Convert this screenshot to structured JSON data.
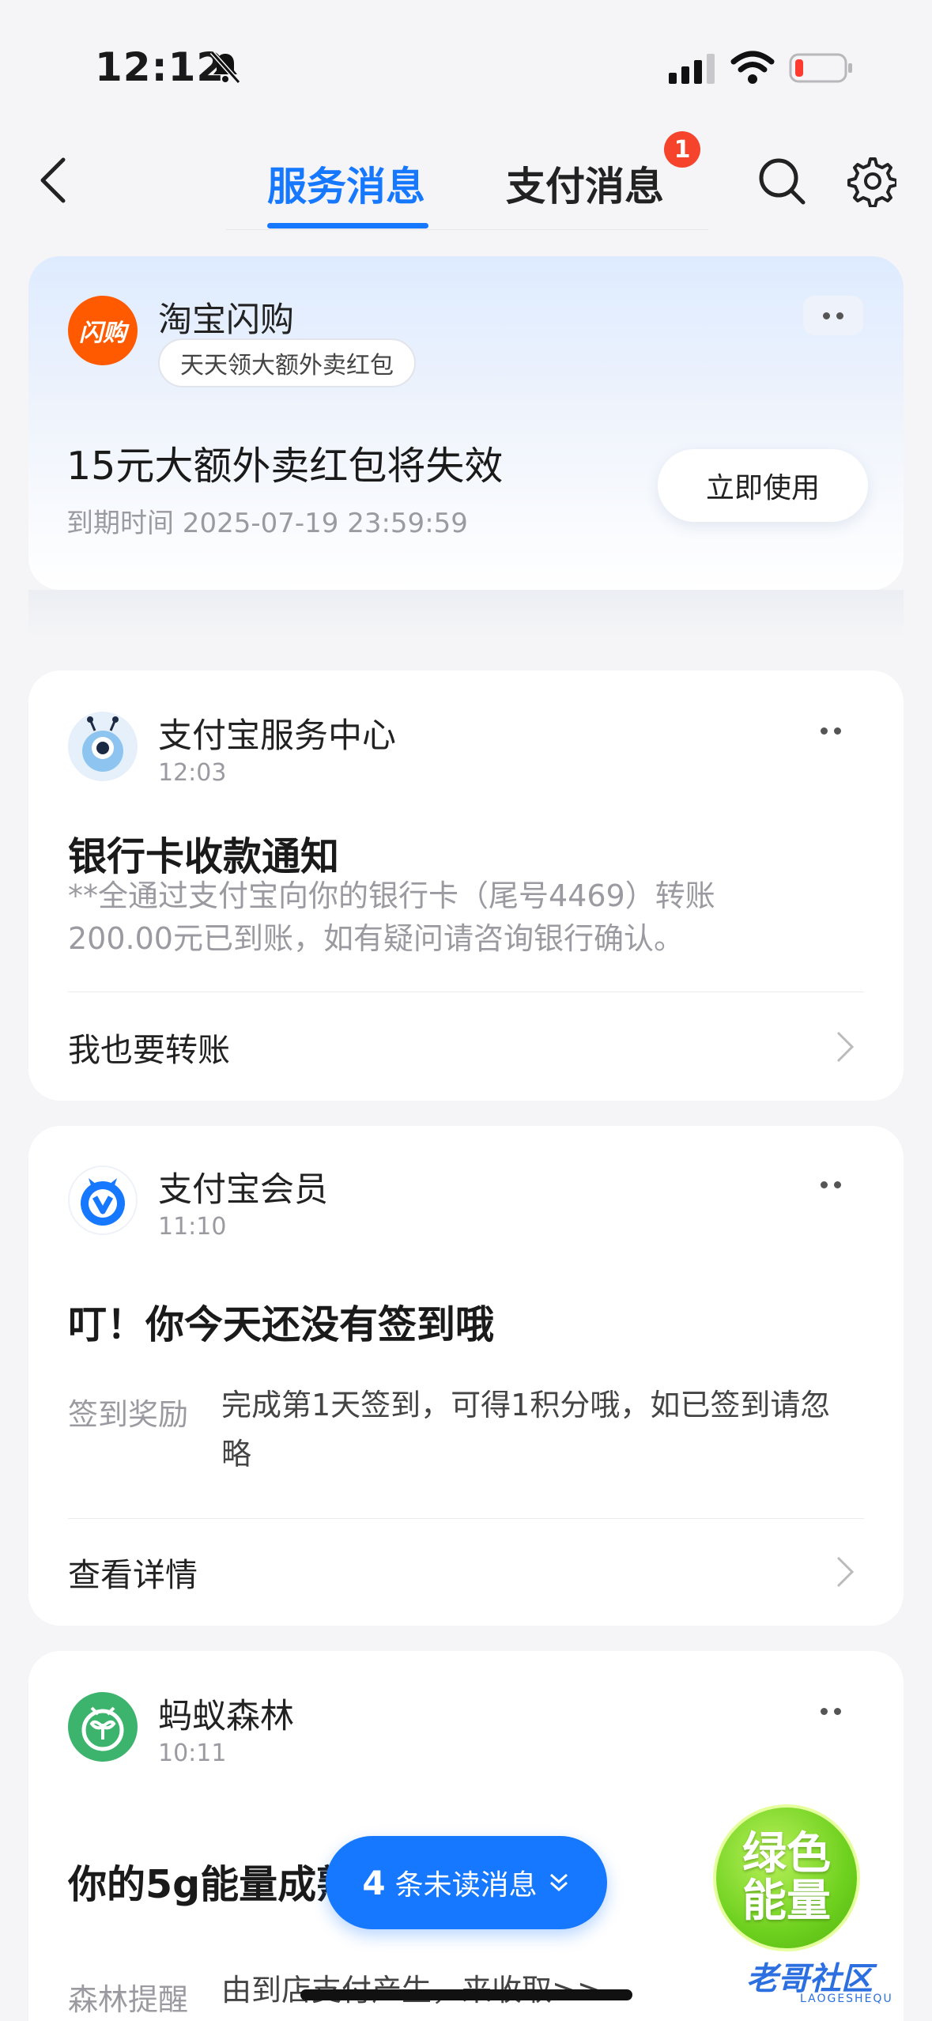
{
  "status_bar": {
    "time": "12:12"
  },
  "header": {
    "tabs": [
      {
        "label": "服务消息",
        "active": true
      },
      {
        "label": "支付消息",
        "badge": "1"
      }
    ]
  },
  "promo_card": {
    "brand_logo_text": "闪购",
    "brand_name": "淘宝闪购",
    "tag": "天天领大额外卖红包",
    "headline": "15元大额外卖红包将失效",
    "expiry": "到期时间 2025-07-19 23:59:59",
    "cta": "立即使用"
  },
  "messages": [
    {
      "sender": "支付宝服务中心",
      "time": "12:03",
      "title": "银行卡收款通知",
      "body_line1": "**全通过支付宝向你的银行卡（尾号4469）转账",
      "body_line2": "200.00元已到账，如有疑问请咨询银行确认。",
      "action": "我也要转账"
    },
    {
      "sender": "支付宝会员",
      "time": "11:10",
      "title": "叮！你今天还没有签到哦",
      "kv_key": "签到奖励",
      "kv_val_line1": "完成第1天签到，可得1积分哦，如已签到请忽",
      "kv_val_line2": "略",
      "action": "查看详情"
    },
    {
      "sender": "蚂蚁森林",
      "time": "10:11",
      "title": "你的5g能量成熟了",
      "kv_key": "森林提醒",
      "kv_val": "由到店支付产生，来收取>>"
    }
  ],
  "floating": {
    "unread_count": "4",
    "unread_label": "条未读消息",
    "energy_line1": "绿色",
    "energy_line2": "能量"
  },
  "watermark": {
    "main": "老哥社区",
    "sub": "LAOGESHEQU"
  },
  "colors": {
    "accent": "#1677ff",
    "badge": "#f5432c",
    "promo_orange": "#ff5a00"
  }
}
